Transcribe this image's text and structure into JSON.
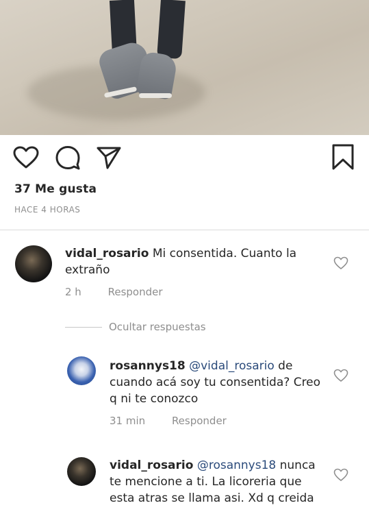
{
  "post": {
    "likes": "37 Me gusta",
    "time": "HACE 4 HORAS"
  },
  "comments": [
    {
      "username": "vidal_rosario",
      "text": "Mi consentida. Cuanto la extraño",
      "time": "2 h",
      "reply_label": "Responder"
    }
  ],
  "hide_replies_label": "Ocultar respuestas",
  "replies": [
    {
      "username": "rosannys18",
      "mention": "@vidal_rosario",
      "text": "de cuando acá soy tu consentida? Creo q ni te conozco",
      "time": "31 min",
      "reply_label": "Responder"
    },
    {
      "username": "vidal_rosario",
      "mention": "@rosannys18",
      "text": "nunca te mencione a ti. La licoreria que esta atras se llama asi. Xd q creida"
    }
  ],
  "icons": [
    "heart-icon",
    "comment-icon",
    "share-icon",
    "bookmark-icon",
    "like-comment-icon"
  ],
  "colors": {
    "text": "#262626",
    "muted": "#8e8e8e",
    "divider": "#dbdbdb"
  }
}
